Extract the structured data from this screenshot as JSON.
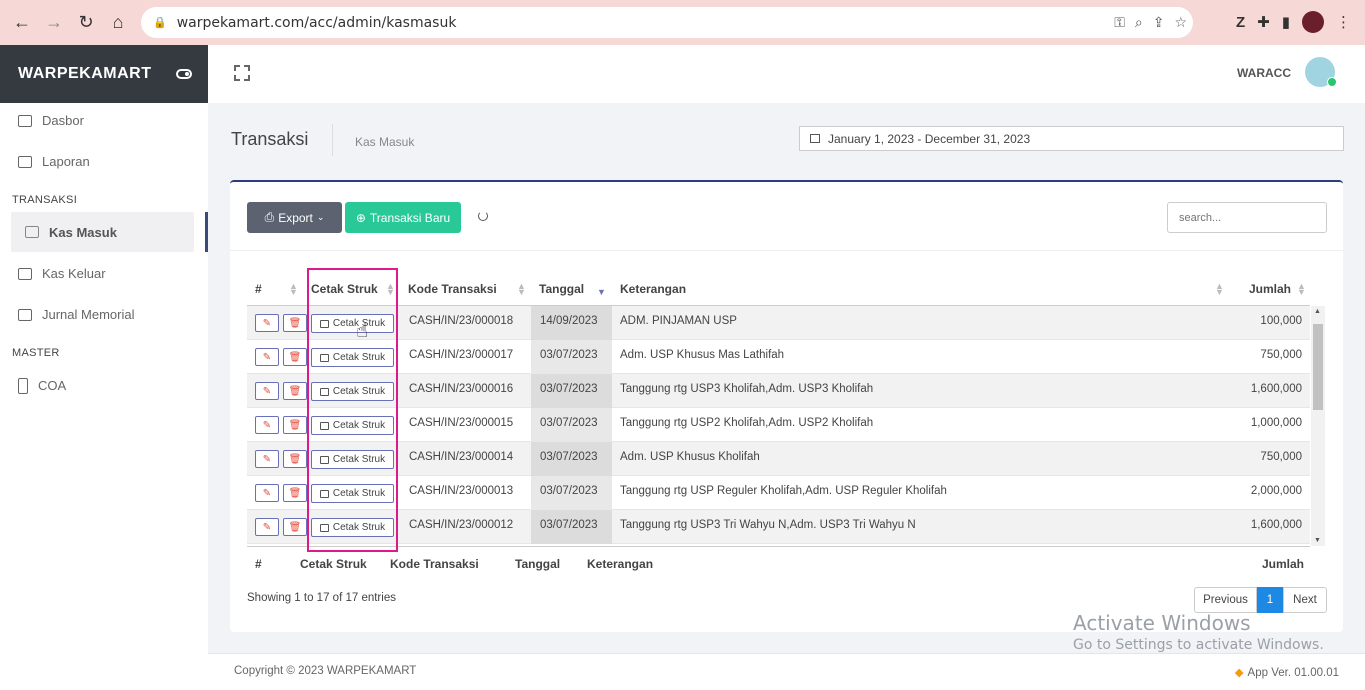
{
  "browser": {
    "url": "warpekamart.com/acc/admin/kasmasuk"
  },
  "sidebar": {
    "brand": "WARPEKAMART",
    "items_top": [
      {
        "label": "Dasbor",
        "icon": "dashboard-icon"
      },
      {
        "label": "Laporan",
        "icon": "report-icon"
      }
    ],
    "section_transaksi": "TRANSAKSI",
    "items_transaksi": [
      {
        "label": "Kas Masuk",
        "icon": "bank-icon",
        "active": true
      },
      {
        "label": "Kas Keluar",
        "icon": "cash-icon"
      },
      {
        "label": "Jurnal Memorial",
        "icon": "book-icon"
      }
    ],
    "section_master": "MASTER",
    "items_master": [
      {
        "label": "COA",
        "icon": "columns-icon"
      }
    ]
  },
  "header": {
    "user": "WARACC"
  },
  "page": {
    "title": "Transaksi",
    "subtitle": "Kas Masuk",
    "date_range": "January 1, 2023 - December 31, 2023"
  },
  "toolbar": {
    "export_label": "Export",
    "new_label": "Transaksi Baru",
    "search_placeholder": "search..."
  },
  "table": {
    "headers": {
      "num": "#",
      "cetak": "Cetak Struk",
      "kode": "Kode Transaksi",
      "tanggal": "Tanggal",
      "keterangan": "Keterangan",
      "jumlah": "Jumlah"
    },
    "print_label": "Cetak Struk",
    "rows": [
      {
        "kode": "CASH/IN/23/000018",
        "tanggal": "14/09/2023",
        "keterangan": "ADM. PINJAMAN USP",
        "jumlah": "100,000"
      },
      {
        "kode": "CASH/IN/23/000017",
        "tanggal": "03/07/2023",
        "keterangan": "Adm. USP Khusus Mas Lathifah",
        "jumlah": "750,000"
      },
      {
        "kode": "CASH/IN/23/000016",
        "tanggal": "03/07/2023",
        "keterangan": "Tanggung rtg USP3 Kholifah,Adm. USP3 Kholifah",
        "jumlah": "1,600,000"
      },
      {
        "kode": "CASH/IN/23/000015",
        "tanggal": "03/07/2023",
        "keterangan": "Tanggung rtg USP2 Kholifah,Adm. USP2 Kholifah",
        "jumlah": "1,000,000"
      },
      {
        "kode": "CASH/IN/23/000014",
        "tanggal": "03/07/2023",
        "keterangan": "Adm. USP Khusus Kholifah",
        "jumlah": "750,000"
      },
      {
        "kode": "CASH/IN/23/000013",
        "tanggal": "03/07/2023",
        "keterangan": "Tanggung rtg USP Reguler Kholifah,Adm. USP Reguler Kholifah",
        "jumlah": "2,000,000"
      },
      {
        "kode": "CASH/IN/23/000012",
        "tanggal": "03/07/2023",
        "keterangan": "Tanggung rtg USP3 Tri Wahyu N,Adm. USP3 Tri Wahyu N",
        "jumlah": "1,600,000"
      }
    ],
    "info": "Showing 1 to 17 of 17 entries",
    "pager": {
      "prev": "Previous",
      "current": "1",
      "next": "Next"
    }
  },
  "watermark": {
    "line1": "Activate Windows",
    "line2": "Go to Settings to activate Windows."
  },
  "footer": {
    "copyright": "Copyright © 2023 WARPEKAMART",
    "version": "App Ver. 01.00.01"
  }
}
